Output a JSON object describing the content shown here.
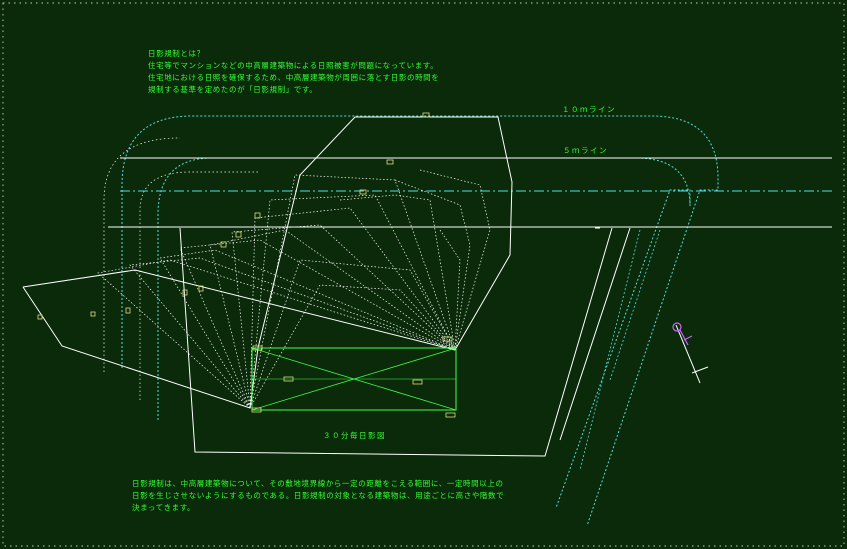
{
  "intro_lines": [
    "日影規制とは？",
    "住宅等でマンションなどの中高層建築物による日照被害が問題になっています。",
    "住宅地における日照を確保するため、中高層建築物が周囲に落とす日影の時間を",
    "規制する基準を定めたのが「日影規制」です。"
  ],
  "labels": {
    "line_10m": "１０ｍライン",
    "line_5m": "５ｍライン",
    "shadow_30min": "３０分毎日影図"
  },
  "footer_lines": [
    "日影規制は、中高層建築物について、その敷地境界線から一定の距離をこえる範囲に、一定時間以上の",
    "日影を生じさせないようにするものである。日影規制の対象となる建築物は、用途ごとに高さや階数で",
    "決まってきます。"
  ],
  "colors": {
    "background": "#0a2a0a",
    "text": "#33ff33",
    "lines": "#ffffff",
    "boundary": "#55dddd",
    "building": "#44ff44",
    "marker": "#dddd88",
    "accent": "#cc66ff"
  }
}
